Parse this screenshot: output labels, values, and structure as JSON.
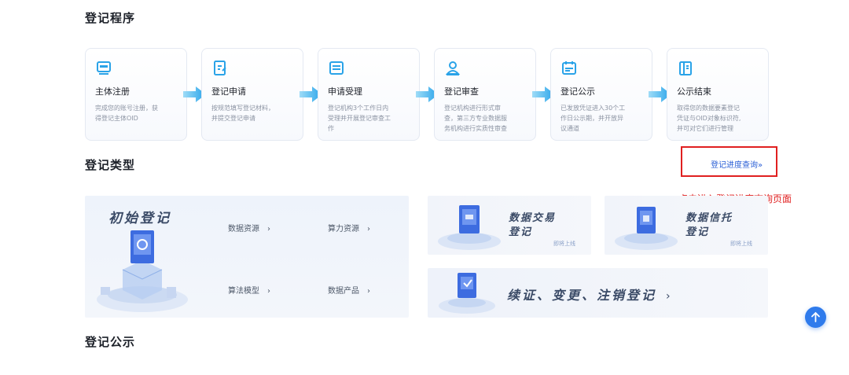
{
  "sections": {
    "procedure": "登记程序",
    "types": "登记类型",
    "publicity": "登记公示"
  },
  "steps": [
    {
      "title": "主体注册",
      "desc1": "完成您的账号注册，获",
      "desc2": "得登记主体OID",
      "desc3": ""
    },
    {
      "title": "登记申请",
      "desc1": "按规范填写登记材料，",
      "desc2": "并提交登记申请",
      "desc3": ""
    },
    {
      "title": "申请受理",
      "desc1": "登记机构3个工作日内",
      "desc2": "受理并开展登记审查工",
      "desc3": "作"
    },
    {
      "title": "登记审查",
      "desc1": "登记机构进行形式审",
      "desc2": "查，第三方专业数据服",
      "desc3": "务机构进行实质性审查"
    },
    {
      "title": "登记公示",
      "desc1": "已发放凭证进入30个工",
      "desc2": "作日公示期，并开放异",
      "desc3": "议通道"
    },
    {
      "title": "公示结束",
      "desc1": "取得您的数据要素登记",
      "desc2": "凭证与OID对象标识符,",
      "desc3": "并可对它们进行管理"
    }
  ],
  "query_link": "登记进度查询»",
  "annotation": "点击进入登记进度查询页面",
  "initial": {
    "title": "初始登记",
    "items": [
      "数据资源",
      "算力资源",
      "算法模型",
      "数据产品"
    ],
    "chevron": "›"
  },
  "cards": [
    {
      "line1": "数据交易",
      "line2": "登记",
      "soon": "即将上线"
    },
    {
      "line1": "数据信托",
      "line2": "登记",
      "soon": "即将上线"
    }
  ],
  "wide_card": {
    "title": "续证、变更、注销登记",
    "chevron": "›"
  },
  "colors": {
    "accent": "#2f7bec",
    "icon": "#2aa3e8",
    "annotation": "#e02020"
  }
}
